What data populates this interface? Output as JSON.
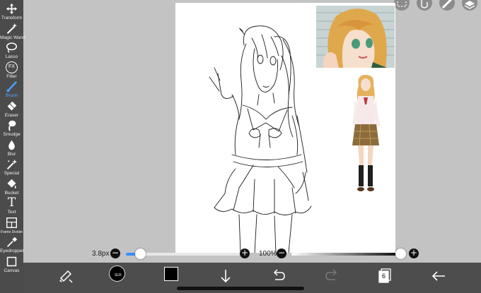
{
  "toolbar": {
    "items": [
      {
        "label": "Transform",
        "icon": "move-arrows-icon"
      },
      {
        "label": "Magic Wand",
        "icon": "magic-wand-icon"
      },
      {
        "label": "Lasso",
        "icon": "lasso-icon"
      },
      {
        "label": "Filter",
        "icon": "fx-icon"
      },
      {
        "label": "Brush",
        "icon": "brush-icon",
        "selected": true
      },
      {
        "label": "Eraser",
        "icon": "eraser-icon"
      },
      {
        "label": "Smudge",
        "icon": "smudge-icon"
      },
      {
        "label": "Blur",
        "icon": "blur-drop-icon"
      },
      {
        "label": "Special",
        "icon": "special-wand-icon"
      },
      {
        "label": "Bucket",
        "icon": "bucket-icon"
      },
      {
        "label": "Text",
        "icon": "text-icon"
      },
      {
        "label": "Frame Divider",
        "icon": "frame-divider-icon"
      },
      {
        "label": "Eyedropper",
        "icon": "eyedropper-icon"
      },
      {
        "label": "Canvas",
        "icon": "canvas-icon"
      }
    ],
    "filter_glyph": "FX",
    "text_glyph": "T"
  },
  "slider_row": {
    "brush_size": "3.8px",
    "opacity": "100%",
    "minus": "−",
    "plus": "+"
  },
  "bottom_bar": {
    "layer_count": "6",
    "color_badge": "SLR"
  },
  "colors": {
    "accent": "#3d8cff",
    "toolbar_bg": "#4b4b4b",
    "bottom_bg": "#4d4d4d",
    "workspace_bg": "#c3c3c3",
    "brush_color": "#000000"
  }
}
